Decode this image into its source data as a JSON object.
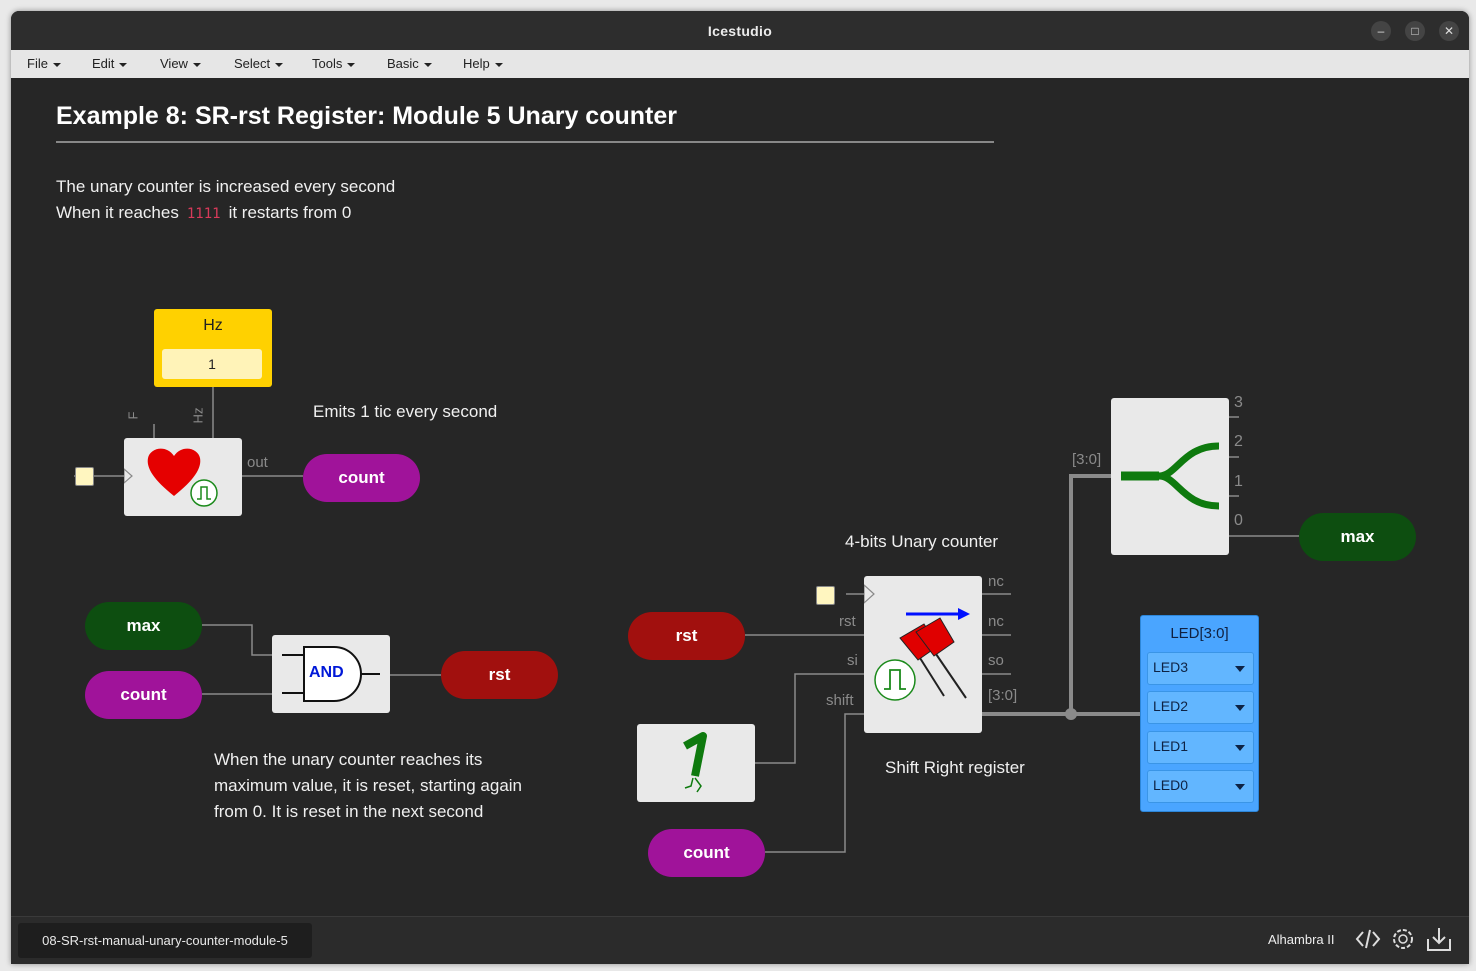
{
  "window": {
    "title": "Icestudio"
  },
  "menu": [
    "File",
    "Edit",
    "View",
    "Select",
    "Tools",
    "Basic",
    "Help"
  ],
  "doc": {
    "heading": "Example 8: SR-rst Register: Module 5 Unary counter",
    "line1": "The unary counter is increased every second",
    "line2_pre": "When it reaches",
    "line2_code": "1111",
    "line2_post": "it restarts from 0",
    "hz_comment": "Emits 1 tic every second",
    "reset_comment": [
      "When the unary counter reaches its",
      "maximum value, it is reset, starting again",
      "from 0. It is reset in the next second"
    ],
    "counter_comment": "4-bits Unary counter",
    "register_comment": "Shift Right register"
  },
  "hz": {
    "title": "Hz",
    "value": "1",
    "pin_f": "F",
    "pin_hz": "Hz",
    "pin_out": "out"
  },
  "labels": {
    "count": "count",
    "max": "max",
    "rst": "rst"
  },
  "and_gate": {
    "text": "AND"
  },
  "register": {
    "pins_left": [
      "rst",
      "si",
      "shift"
    ],
    "pins_right": [
      "nc",
      "nc",
      "so",
      "[3:0]"
    ]
  },
  "splitter": {
    "bus": "[3:0]",
    "outs": [
      "3",
      "2",
      "1",
      "0"
    ]
  },
  "leds": {
    "title": "LED[3:0]",
    "items": [
      "LED3",
      "LED2",
      "LED1",
      "LED0"
    ]
  },
  "status": {
    "filename": "08-SR-rst-manual-unary-counter-module-5",
    "board": "Alhambra II"
  },
  "icons": [
    "heart-icon",
    "pulse-icon",
    "pushpin-icon",
    "arrow-right-icon",
    "constant-one-icon",
    "split-icon",
    "code-icon",
    "settings-icon",
    "download-icon"
  ],
  "colors": {
    "accent_purple": "#a0139a",
    "accent_green": "#0d4e10",
    "accent_red": "#a1100e",
    "hz_yellow": "#ffd100",
    "led_blue": "#4aa5ff"
  }
}
